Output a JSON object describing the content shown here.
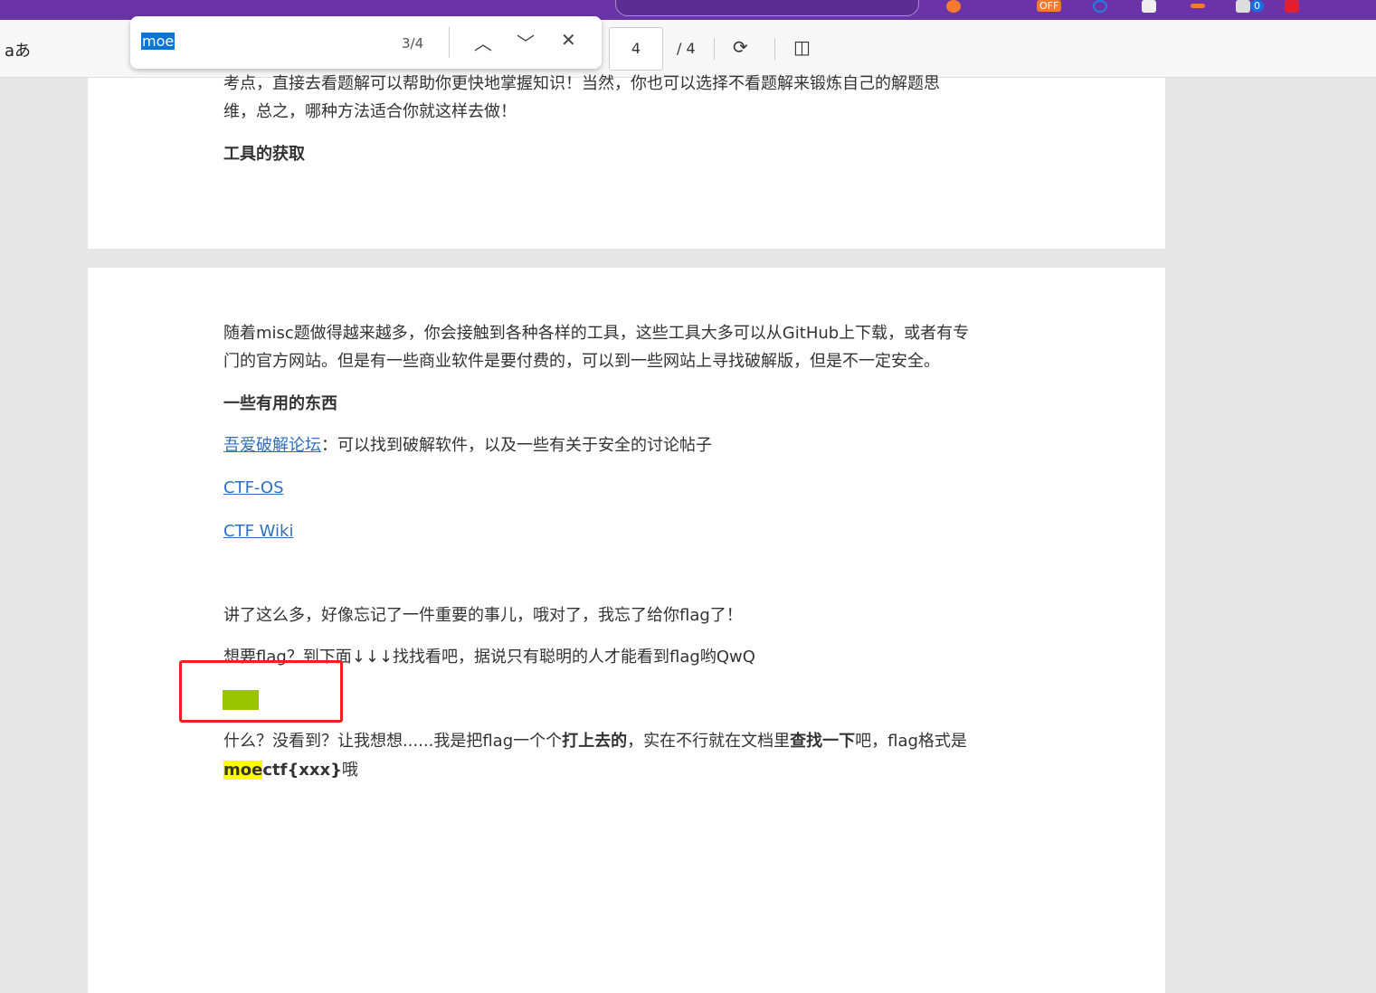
{
  "toolbar": {
    "read_aloud": "aあ",
    "page_number": "4",
    "page_total": "/ 4"
  },
  "find": {
    "query": "moe",
    "count": "3/4"
  },
  "browser": {
    "extension_badge": "OFF",
    "notif_count": "0"
  },
  "page3": {
    "line1": "考点，直接去看题解可以帮助你更快地掌握知识！当然，你也可以选择不看题解来锻炼自己的解题思",
    "line2": "维，总之，哪种方法适合你就这样去做！",
    "heading": "工具的获取"
  },
  "page4": {
    "p1a": "随着misc题做得越来越多，你会接触到各种各样的工具，这些工具大多可以从GitHub上下载，或者有专",
    "p1b": "门的官方网站。但是有一些商业软件是要付费的，可以到一些网站上寻找破解版，但是不一定安全。",
    "heading": "一些有用的东西",
    "link1": "吾爱破解论坛",
    "link1_desc": "：可以找到破解软件，以及一些有关于安全的讨论帖子",
    "link2": "CTF-OS",
    "link3": "CTF Wiki",
    "p2": "讲了这么多，好像忘记了一件重要的事儿，哦对了，我忘了给你flag了！",
    "p3": "想要flag？到下面↓↓↓找找看吧，据说只有聪明的人才能看到flag哟QwQ",
    "p4_a": "什么？没看到？让我想想......我是把flag一个个",
    "p4_b": "打上去的",
    "p4_c": "，实在不行就在文档里",
    "p4_d": "查找一下",
    "p4_e": "吧，flag格式是",
    "p5_hl": "moe",
    "p5_bold": "ctf{xxx}",
    "p5_end": "哦"
  }
}
